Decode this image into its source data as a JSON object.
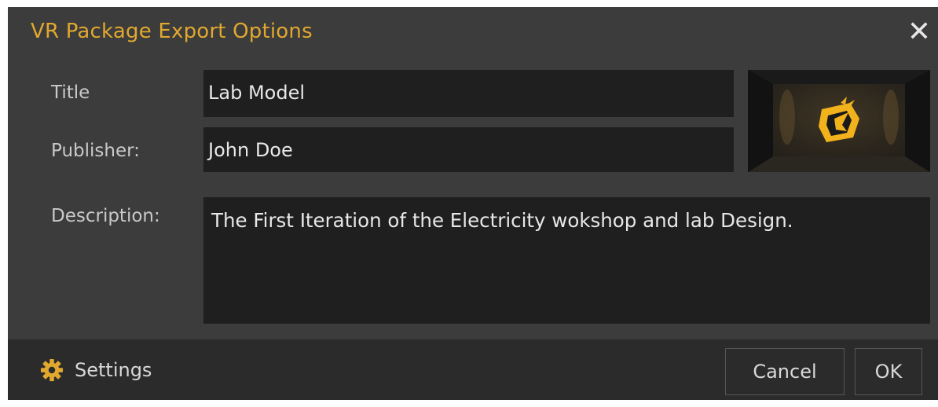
{
  "dialog": {
    "title": "VR Package Export Options",
    "close_icon": "close-icon"
  },
  "form": {
    "title_label": "Title",
    "title_value": "Lab Model",
    "publisher_label": "Publisher:",
    "publisher_value": "John Doe",
    "description_label": "Description:",
    "description_value": "The First Iteration of the Electricity wokshop and lab Design."
  },
  "thumbnail": {
    "icon": "dragon-logo-icon"
  },
  "footer": {
    "settings_label": "Settings",
    "settings_icon": "gear-icon",
    "cancel_label": "Cancel",
    "ok_label": "OK"
  },
  "colors": {
    "accent": "#e0a82e",
    "dialog_bg": "#3c3c3c",
    "field_bg": "#1f1f1f",
    "footer_bg": "#2b2b2b"
  }
}
